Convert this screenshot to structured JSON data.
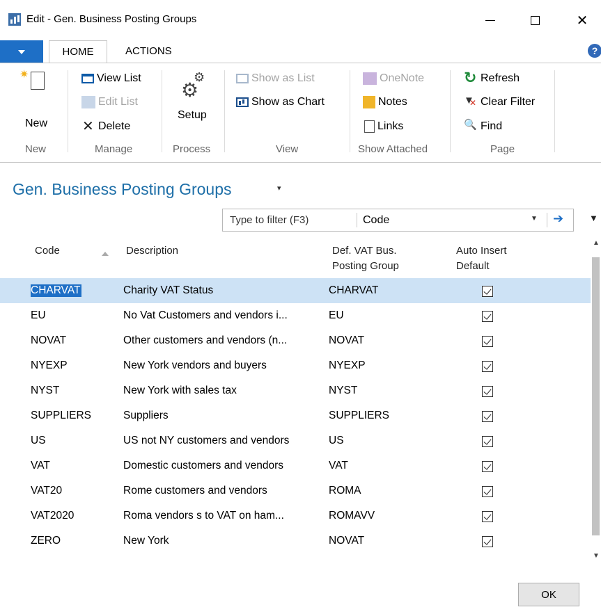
{
  "window": {
    "title": "Edit - Gen. Business Posting Groups",
    "close_glyph": "✕"
  },
  "ribbon_tabs": [
    {
      "label": "HOME"
    },
    {
      "label": "ACTIONS"
    }
  ],
  "help": {
    "glyph": "?"
  },
  "ribbon": {
    "groups": {
      "new": "New",
      "manage": "Manage",
      "process": "Process",
      "view": "View",
      "show_attached": "Show Attached",
      "page": "Page"
    },
    "buttons": {
      "new": "New",
      "view_list": "View List",
      "edit_list": "Edit List",
      "delete": "Delete",
      "setup": "Setup",
      "show_as_list": "Show as List",
      "show_as_chart": "Show as Chart",
      "onenote": "OneNote",
      "notes": "Notes",
      "links": "Links",
      "refresh": "Refresh",
      "clear_filter": "Clear Filter",
      "find": "Find"
    }
  },
  "page": {
    "title": "Gen. Business Posting Groups",
    "title_dropdown": "▾"
  },
  "filter": {
    "placeholder": "Type to filter (F3)",
    "field": "Code"
  },
  "table": {
    "headers": {
      "code": "Code",
      "description": "Description",
      "def_vat_line1": "Def. VAT Bus.",
      "def_vat_line2": "Posting Group",
      "auto_line1": "Auto Insert",
      "auto_line2": "Default"
    },
    "rows": [
      {
        "code": "CHARVAT",
        "description": "Charity VAT Status",
        "def_vat": "CHARVAT",
        "auto_insert": true
      },
      {
        "code": "EU",
        "description": "No Vat Customers and vendors i...",
        "def_vat": "EU",
        "auto_insert": true
      },
      {
        "code": "NOVAT",
        "description": "Other customers and vendors (n...",
        "def_vat": "NOVAT",
        "auto_insert": true
      },
      {
        "code": "NYEXP",
        "description": "New York vendors and buyers",
        "def_vat": "NYEXP",
        "auto_insert": true
      },
      {
        "code": "NYST",
        "description": "New York with sales tax",
        "def_vat": "NYST",
        "auto_insert": true
      },
      {
        "code": "SUPPLIERS",
        "description": "Suppliers",
        "def_vat": "SUPPLIERS",
        "auto_insert": true
      },
      {
        "code": "US",
        "description": "US not NY customers and vendors",
        "def_vat": "US",
        "auto_insert": true
      },
      {
        "code": "VAT",
        "description": "Domestic customers and vendors",
        "def_vat": "VAT",
        "auto_insert": true
      },
      {
        "code": "VAT20",
        "description": "Rome customers and vendors",
        "def_vat": "ROMA",
        "auto_insert": true
      },
      {
        "code": "VAT2020",
        "description": "Roma vendors s to VAT on ham...",
        "def_vat": "ROMAVV",
        "auto_insert": true
      },
      {
        "code": "ZERO",
        "description": "New York",
        "def_vat": "NOVAT",
        "auto_insert": true
      }
    ]
  },
  "footer": {
    "ok": "OK"
  }
}
